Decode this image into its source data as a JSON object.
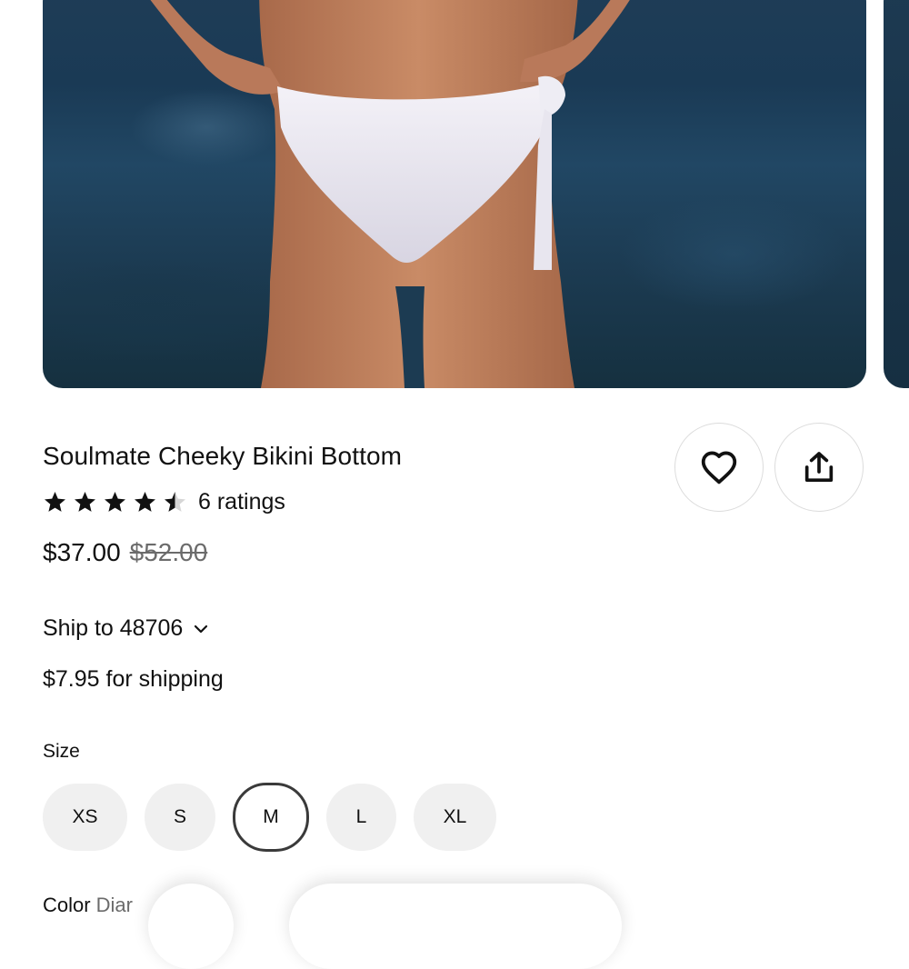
{
  "hero": {
    "alt": "product photo: white cheeky bikini bottom with side tie"
  },
  "product": {
    "title": "Soulmate Cheeky Bikini Bottom",
    "rating_value": 4.5,
    "rating_text": "6 ratings",
    "price": "$37.00",
    "original_price": "$52.00"
  },
  "shipping": {
    "ship_to": "Ship to 48706",
    "cost": "$7.95 for shipping"
  },
  "size": {
    "label": "Size",
    "options": [
      "XS",
      "S",
      "M",
      "L",
      "XL"
    ],
    "selected": "M"
  },
  "color": {
    "label": "Color",
    "value": "Diar"
  },
  "icons": {
    "favorite": "heart-icon",
    "share": "share-icon",
    "dropdown": "chevron-down-icon",
    "star": "star-icon"
  },
  "colors": {
    "text": "#111111",
    "muted": "#6b6b6b",
    "pill_bg": "#f0f0f0",
    "selected_border": "#3a3a3a"
  }
}
